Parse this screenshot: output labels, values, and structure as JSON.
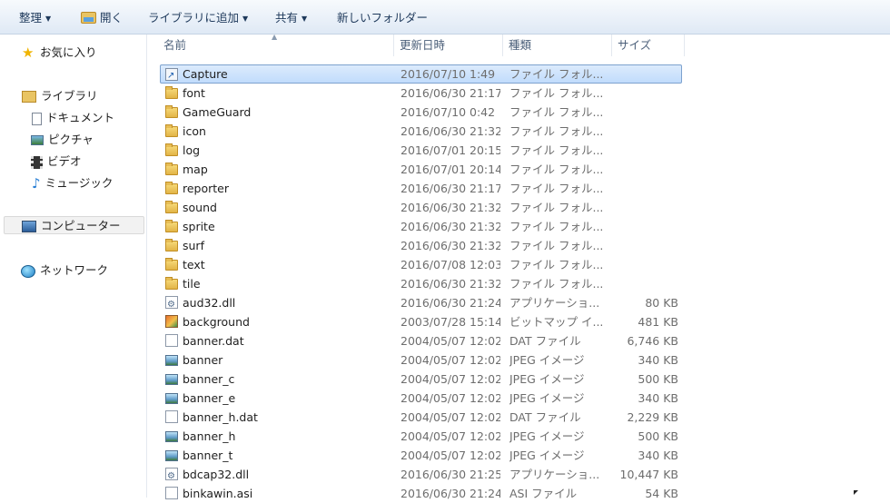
{
  "toolbar": {
    "organize": "整理",
    "open": "開く",
    "add_to_library": "ライブラリに追加",
    "share": "共有",
    "new_folder": "新しいフォルダー"
  },
  "nav": {
    "favorites": "お気に入り",
    "libraries": "ライブラリ",
    "documents": "ドキュメント",
    "pictures": "ピクチャ",
    "videos": "ビデオ",
    "music": "ミュージック",
    "computer": "コンピューター",
    "network": "ネットワーク"
  },
  "columns": {
    "name": "名前",
    "modified": "更新日時",
    "type": "種類",
    "size": "サイズ"
  },
  "files": [
    {
      "name": "Capture",
      "date": "2016/07/10 1:49",
      "type": "ファイル フォル...",
      "size": "",
      "icon": "folder-shortcut-icon"
    },
    {
      "name": "font",
      "date": "2016/06/30 21:17",
      "type": "ファイル フォル...",
      "size": "",
      "icon": "folder-icon"
    },
    {
      "name": "GameGuard",
      "date": "2016/07/10 0:42",
      "type": "ファイル フォル...",
      "size": "",
      "icon": "folder-icon"
    },
    {
      "name": "icon",
      "date": "2016/06/30 21:32",
      "type": "ファイル フォル...",
      "size": "",
      "icon": "folder-icon"
    },
    {
      "name": "log",
      "date": "2016/07/01 20:15",
      "type": "ファイル フォル...",
      "size": "",
      "icon": "folder-icon"
    },
    {
      "name": "map",
      "date": "2016/07/01 20:14",
      "type": "ファイル フォル...",
      "size": "",
      "icon": "folder-icon"
    },
    {
      "name": "reporter",
      "date": "2016/06/30 21:17",
      "type": "ファイル フォル...",
      "size": "",
      "icon": "folder-icon"
    },
    {
      "name": "sound",
      "date": "2016/06/30 21:32",
      "type": "ファイル フォル...",
      "size": "",
      "icon": "folder-icon"
    },
    {
      "name": "sprite",
      "date": "2016/06/30 21:32",
      "type": "ファイル フォル...",
      "size": "",
      "icon": "folder-icon"
    },
    {
      "name": "surf",
      "date": "2016/06/30 21:32",
      "type": "ファイル フォル...",
      "size": "",
      "icon": "folder-icon"
    },
    {
      "name": "text",
      "date": "2016/07/08 12:03",
      "type": "ファイル フォル...",
      "size": "",
      "icon": "folder-icon"
    },
    {
      "name": "tile",
      "date": "2016/06/30 21:32",
      "type": "ファイル フォル...",
      "size": "",
      "icon": "folder-icon"
    },
    {
      "name": "aud32.dll",
      "date": "2016/06/30 21:24",
      "type": "アプリケーショ...",
      "size": "80 KB",
      "icon": "dll-icon"
    },
    {
      "name": "background",
      "date": "2003/07/28 15:14",
      "type": "ビットマップ イ...",
      "size": "481 KB",
      "icon": "bitmap-icon"
    },
    {
      "name": "banner.dat",
      "date": "2004/05/07 12:02",
      "type": "DAT ファイル",
      "size": "6,746 KB",
      "icon": "file-icon"
    },
    {
      "name": "banner",
      "date": "2004/05/07 12:02",
      "type": "JPEG イメージ",
      "size": "340 KB",
      "icon": "jpeg-icon"
    },
    {
      "name": "banner_c",
      "date": "2004/05/07 12:02",
      "type": "JPEG イメージ",
      "size": "500 KB",
      "icon": "jpeg-icon"
    },
    {
      "name": "banner_e",
      "date": "2004/05/07 12:02",
      "type": "JPEG イメージ",
      "size": "340 KB",
      "icon": "jpeg-icon"
    },
    {
      "name": "banner_h.dat",
      "date": "2004/05/07 12:02",
      "type": "DAT ファイル",
      "size": "2,229 KB",
      "icon": "file-icon"
    },
    {
      "name": "banner_h",
      "date": "2004/05/07 12:02",
      "type": "JPEG イメージ",
      "size": "500 KB",
      "icon": "jpeg-icon"
    },
    {
      "name": "banner_t",
      "date": "2004/05/07 12:02",
      "type": "JPEG イメージ",
      "size": "340 KB",
      "icon": "jpeg-icon"
    },
    {
      "name": "bdcap32.dll",
      "date": "2016/06/30 21:25",
      "type": "アプリケーショ...",
      "size": "10,447 KB",
      "icon": "dll-icon"
    },
    {
      "name": "binkawin.asi",
      "date": "2016/06/30 21:24",
      "type": "ASI ファイル",
      "size": "54 KB",
      "icon": "file-icon"
    }
  ],
  "selected_index": 0
}
